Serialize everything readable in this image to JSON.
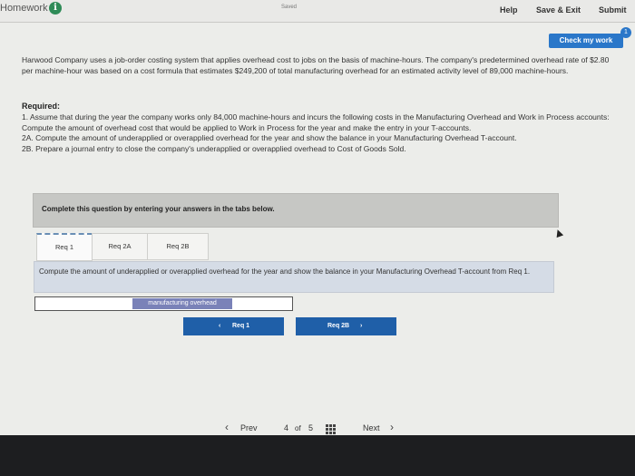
{
  "header": {
    "title": "Homework",
    "saved": "Saved",
    "help": "Help",
    "save_exit": "Save & Exit",
    "submit": "Submit"
  },
  "check": {
    "label": "Check my work",
    "badge": "1"
  },
  "problem": {
    "intro": "Harwood Company uses a job-order costing system that applies overhead cost to jobs on the basis of machine-hours. The company's predetermined overhead rate of $2.80 per machine-hour was based on a cost formula that estimates $249,200 of total manufacturing overhead for an estimated activity level of 89,000 machine-hours.",
    "required_heading": "Required:",
    "req1": "1. Assume that during the year the company works only 84,000 machine-hours and incurs the following costs in the Manufacturing Overhead and Work in Process accounts: Compute the amount of overhead cost that would be applied to Work in Process for the year and make the entry in your T-accounts.",
    "req2a": "2A. Compute the amount of underapplied or overapplied overhead for the year and show the balance in your Manufacturing Overhead T-account.",
    "req2b": "2B. Prepare a journal entry to close the company's underapplied or overapplied overhead to Cost of Goods Sold."
  },
  "complete_note": "Complete this question by entering your answers in the tabs below.",
  "tabs": [
    {
      "label": "Req 1"
    },
    {
      "label": "Req 2A"
    },
    {
      "label": "Req 2B"
    }
  ],
  "instruction": "Compute the amount of underapplied or overapplied overhead for the year and show the balance in your Manufacturing Overhead T-account from Req 1.",
  "account_input": {
    "label": "manufacturing overhead"
  },
  "nav": {
    "prev_label": "Req 1",
    "next_label": "Req 2B"
  },
  "pager": {
    "prev": "Prev",
    "current": "4",
    "of": "of",
    "total": "5",
    "next": "Next"
  },
  "colors": {
    "accent": "#2a77c9",
    "nav_button": "#1f5fa8",
    "info_icon": "#2e8b57"
  }
}
